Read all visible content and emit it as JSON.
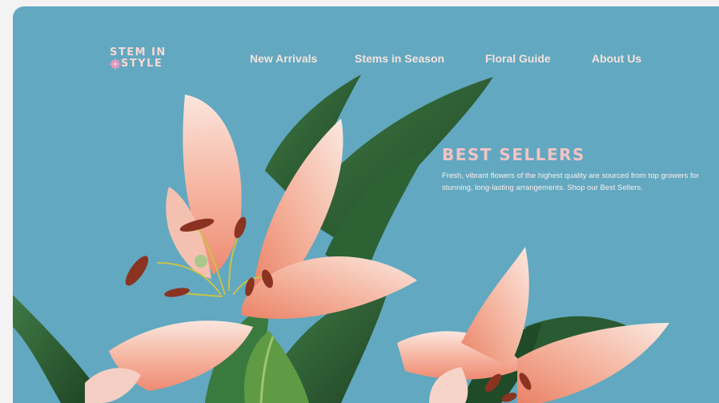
{
  "brand": {
    "line1": "STEM IN",
    "line2": "STYLE",
    "logo_icon": "flower-icon"
  },
  "nav": {
    "items": [
      {
        "label": "New Arrivals"
      },
      {
        "label": "Stems in Season"
      },
      {
        "label": "Floral Guide"
      },
      {
        "label": "About Us"
      }
    ]
  },
  "hero": {
    "title": "BEST SELLERS",
    "body": "Fresh, vibrant flowers of the highest quality are sourced from top growers for stunning, long-lasting arrangements. Shop our Best Sellers."
  },
  "colors": {
    "background": "#62a8c0",
    "logo": "#f7d8d4",
    "nav_text": "#f3e3de",
    "title": "#f3c3c5",
    "body_text": "#fbefee",
    "leaf": "#2e5f35",
    "petal": "#f8d8cc",
    "petal_center": "#ee8a74"
  }
}
